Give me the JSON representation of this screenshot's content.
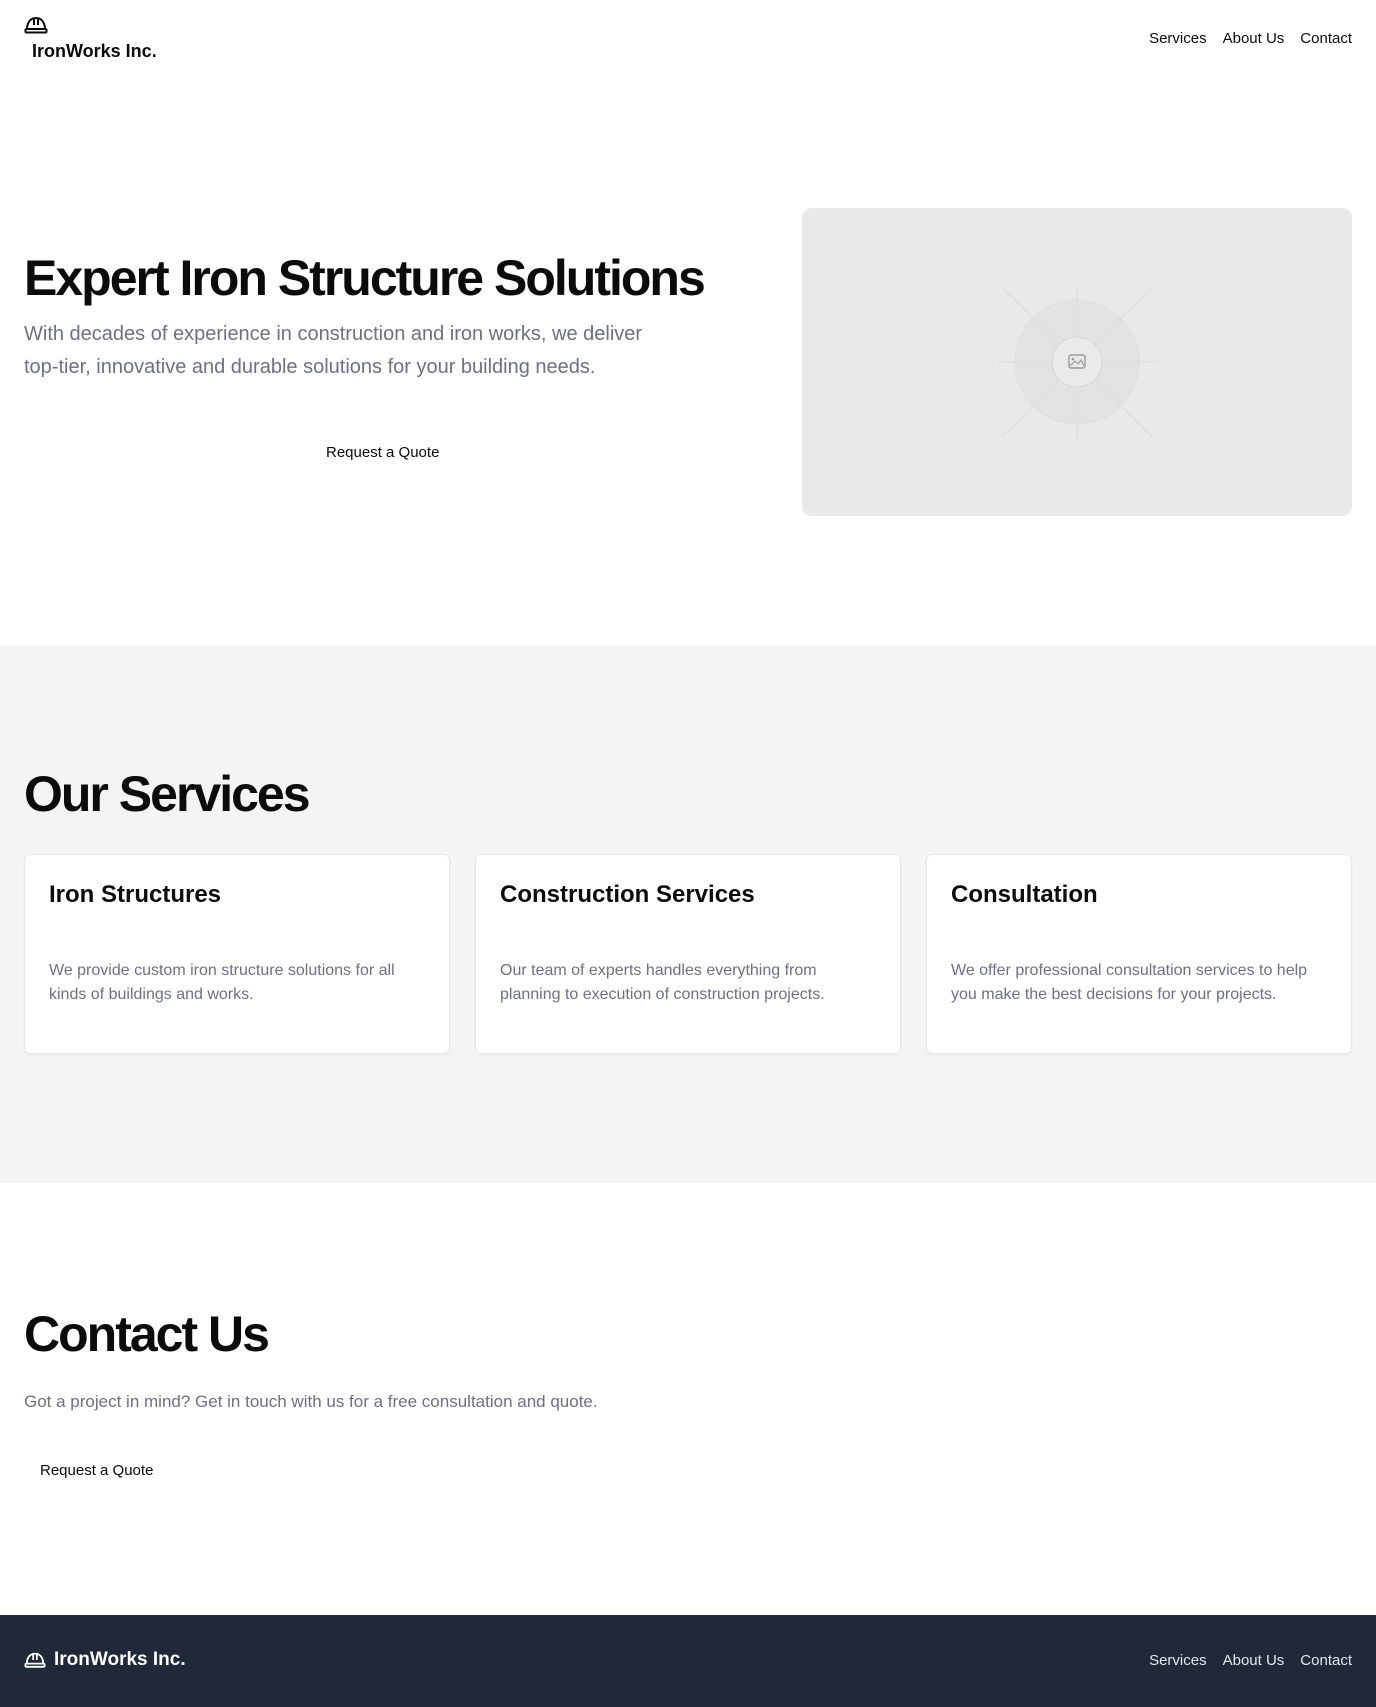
{
  "header": {
    "brand": "IronWorks Inc.",
    "brand_icon": "helmet-icon",
    "nav": [
      "Services",
      "About Us",
      "Contact"
    ]
  },
  "hero": {
    "title": "Expert Iron Structure Solutions",
    "subtitle": "With decades of experience in construction and iron works, we deliver top-tier, innovative and durable solutions for your building needs.",
    "cta": "Request a Quote",
    "image_icon": "image-placeholder-icon"
  },
  "services": {
    "title": "Our Services",
    "cards": [
      {
        "title": "Iron Structures",
        "text": "We provide custom iron structure solutions for all kinds of buildings and works."
      },
      {
        "title": "Construction Services",
        "text": "Our team of experts handles everything from planning to execution of construction projects."
      },
      {
        "title": "Consultation",
        "text": "We offer professional consultation services to help you make the best decisions for your projects."
      }
    ]
  },
  "contact": {
    "title": "Contact Us",
    "text": "Got a project in mind? Get in touch with us for a free consultation and quote.",
    "cta": "Request a Quote"
  },
  "footer": {
    "brand": "IronWorks Inc.",
    "nav": [
      "Services",
      "About Us",
      "Contact"
    ]
  },
  "colors": {
    "services_bg": "#f3f4f6",
    "footer_bg": "#1f2937",
    "muted_text": "#6b7280",
    "placeholder_bg": "#e9e9e9"
  }
}
